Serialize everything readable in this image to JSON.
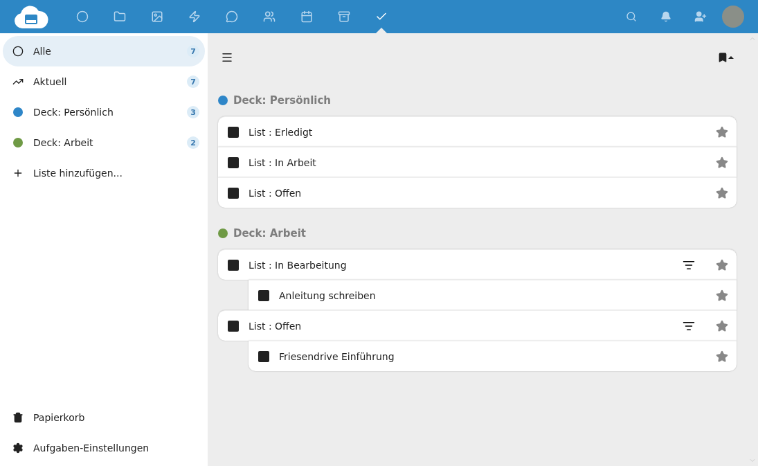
{
  "header": {
    "apps": [
      {
        "kind": "dashboard",
        "selected": false
      },
      {
        "kind": "files",
        "selected": false
      },
      {
        "kind": "photos",
        "selected": false
      },
      {
        "kind": "activity",
        "selected": false
      },
      {
        "kind": "talk",
        "selected": false
      },
      {
        "kind": "contacts",
        "selected": false
      },
      {
        "kind": "calendar",
        "selected": false
      },
      {
        "kind": "deck",
        "selected": false
      },
      {
        "kind": "tasks",
        "selected": true
      }
    ]
  },
  "sidebar": {
    "items": [
      {
        "kind": "all",
        "label": "Alle",
        "count": "7",
        "selected": true
      },
      {
        "kind": "current",
        "label": "Aktuell",
        "count": "7",
        "selected": false
      },
      {
        "kind": "list",
        "label": "Deck: Persönlich",
        "count": "3",
        "color": "#2e86c8",
        "selected": false
      },
      {
        "kind": "list",
        "label": "Deck: Arbeit",
        "count": "2",
        "color": "#6f9a45",
        "selected": false
      },
      {
        "kind": "add",
        "label": "Liste hinzufügen...",
        "selected": false
      }
    ],
    "footer": [
      {
        "kind": "trash",
        "label": "Papierkorb"
      },
      {
        "kind": "settings",
        "label": "Aufgaben-Einstellungen"
      }
    ]
  },
  "groups": [
    {
      "title": "Deck: Persönlich",
      "color": "#2e86c8",
      "tasks": [
        {
          "title": "List : Erledigt",
          "checked": false
        },
        {
          "title": "List : In Arbeit",
          "checked": false
        },
        {
          "title": "List : Offen",
          "checked": false
        }
      ]
    },
    {
      "title": "Deck: Arbeit",
      "color": "#6f9a45",
      "tasks": [
        {
          "title": "List : In Bearbeitung",
          "checked": false,
          "children": [
            {
              "title": "Anleitung schreiben",
              "checked": false
            }
          ]
        },
        {
          "title": "List : Offen",
          "checked": false,
          "children": [
            {
              "title": "Friesendrive Einführung",
              "checked": false
            }
          ]
        }
      ]
    }
  ]
}
